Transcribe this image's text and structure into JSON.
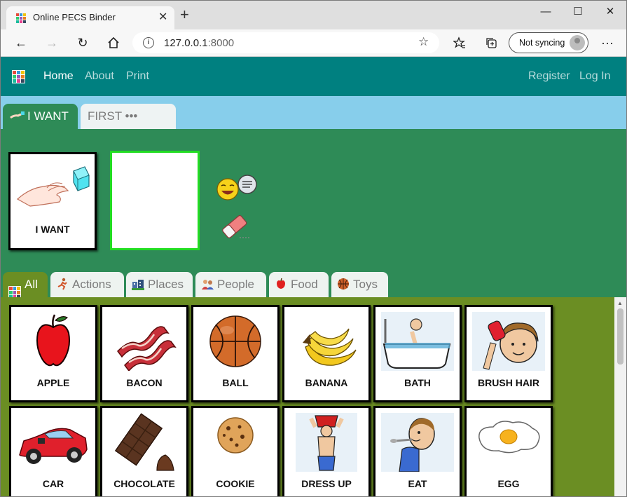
{
  "browser": {
    "tab_title": "Online PECS Binder",
    "url_host": "127.0.0.1",
    "url_port": ":8000",
    "sync_label": "Not syncing"
  },
  "nav": {
    "links": [
      "Home",
      "About",
      "Print"
    ],
    "right_links": [
      "Register",
      "Log In"
    ]
  },
  "sentence_tabs": [
    "I WANT",
    "FIRST ••• THEN"
  ],
  "sentence_strip": {
    "first_card": "I WANT"
  },
  "categories": [
    "All",
    "Actions",
    "Places",
    "People",
    "Food",
    "Toys"
  ],
  "cards": [
    {
      "label": "APPLE",
      "icon": "apple-icon"
    },
    {
      "label": "BACON",
      "icon": "bacon-icon"
    },
    {
      "label": "BALL",
      "icon": "ball-icon"
    },
    {
      "label": "BANANA",
      "icon": "banana-icon"
    },
    {
      "label": "BATH",
      "icon": "bath-icon"
    },
    {
      "label": "BRUSH HAIR",
      "icon": "brush-hair-icon"
    },
    {
      "label": "CAR",
      "icon": "car-icon"
    },
    {
      "label": "CHOCOLATE",
      "icon": "chocolate-icon"
    },
    {
      "label": "COOKIE",
      "icon": "cookie-icon"
    },
    {
      "label": "DRESS UP",
      "icon": "dress-up-icon"
    },
    {
      "label": "EAT",
      "icon": "eat-icon"
    },
    {
      "label": "EGG",
      "icon": "egg-icon"
    }
  ],
  "colors": {
    "nav_bg": "#008080",
    "sentence_tabs_bg": "#87ceeb",
    "strip_bg": "#2e8b57",
    "grid_bg": "#6b8e23",
    "empty_slot_border": "#22dd22"
  }
}
